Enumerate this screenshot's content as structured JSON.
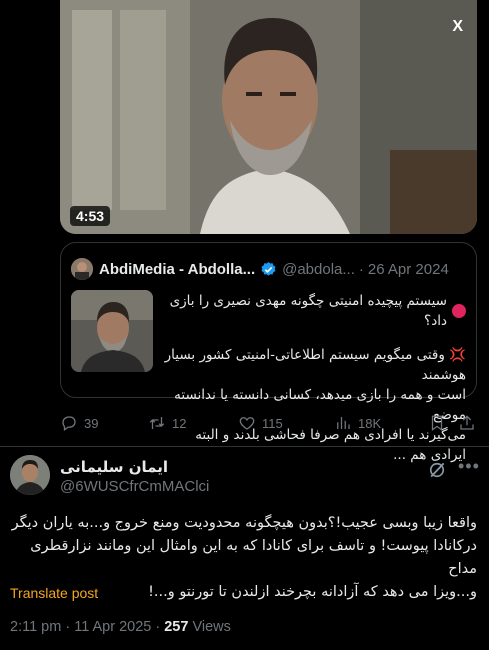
{
  "video": {
    "duration": "4:53",
    "x_logo": "X"
  },
  "quote": {
    "author_name": "AbdiMedia - Abdolla...",
    "author_handle": "@abdola...",
    "date": "26 Apr 2024",
    "line1": "سیستم پیچیده امنیتی چگونه مهدی نصیری را بازی داد؟",
    "body_line1": "وقتی میگویم سیستم اطلاعاتی-امنیتی کشور بسیار هوشمند",
    "body_line2": "است و همه را بازی میدهد، کسانی دانسته یا ندانسته موضع",
    "body_line3": "می‌گیرند یا افرادی هم صرفا فحاشی بلدند و البته ایرادی هم ...",
    "burst_emoji": "💢"
  },
  "actions": {
    "replies": "39",
    "retweets": "12",
    "likes": "115",
    "views": "18K"
  },
  "reply": {
    "author_name": "ایمان سلیمانی",
    "author_handle": "@6WUSCfrCmMAClci",
    "text_line1": "واقعا زیبا وبسی عجیب!؟بدون هیچگونه محدودیت ومنع خروج و...به یاران دیگر",
    "text_line2": "درکانادا پیوست! و تاسف برای کانادا که به این وامثال این ومانند نزارقطری مداح",
    "text_line3": "و...ویزا می دهد که آزادانه بچرخند ازلندن تا تورنتو و...!",
    "translate_label": "Translate post",
    "time": "2:11 pm · 11 Apr 2025 · ",
    "views_count": "257",
    "views_label": " Views"
  },
  "colors": {
    "background": "#000000",
    "text": "#e7e9ea",
    "muted": "#71767b",
    "border": "#2f3336",
    "verified": "#1d9bf0",
    "translate": "#f5a623",
    "red_dot": "#e0245e"
  }
}
